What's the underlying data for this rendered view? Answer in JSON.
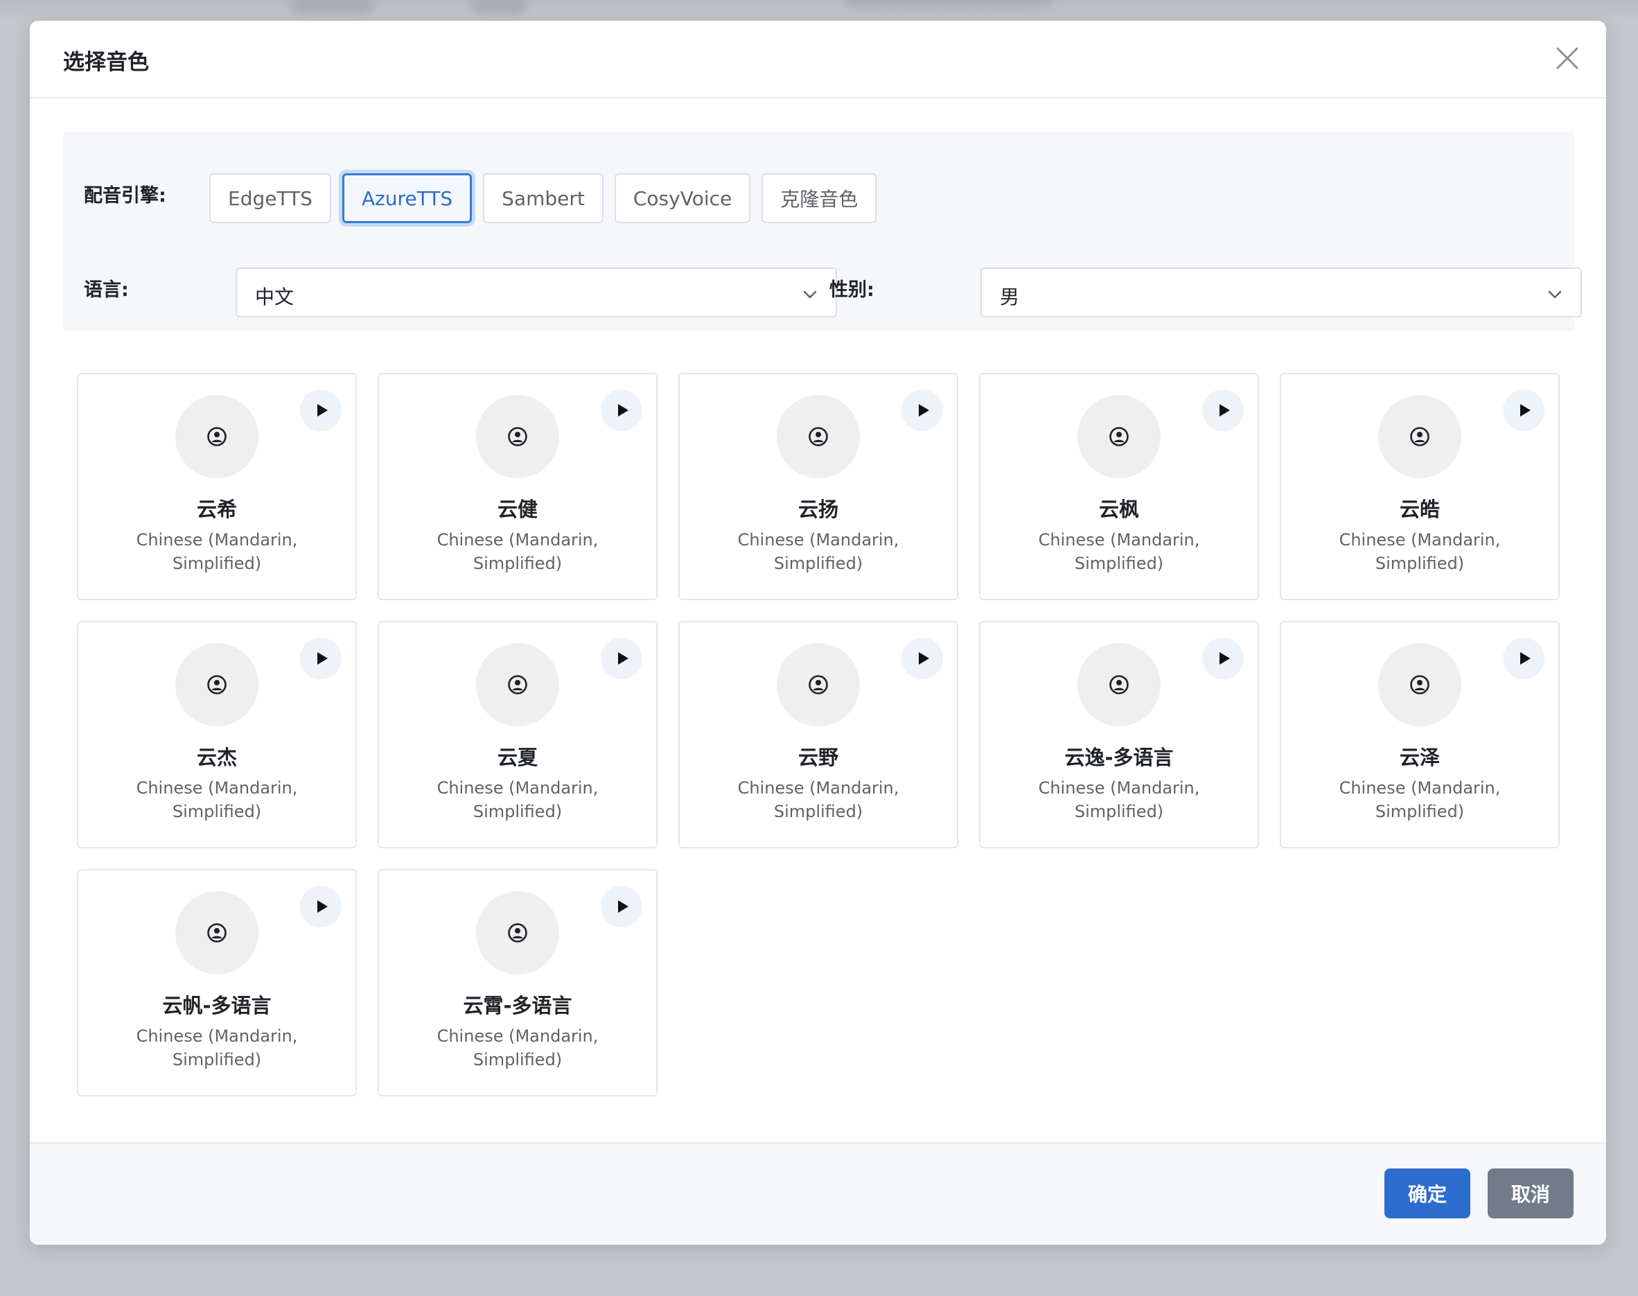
{
  "dialog": {
    "title": "选择音色"
  },
  "filters": {
    "engine_label": "配音引擎:",
    "engines": [
      {
        "label": "EdgeTTS",
        "active": false
      },
      {
        "label": "AzureTTS",
        "active": true
      },
      {
        "label": "Sambert",
        "active": false
      },
      {
        "label": "CosyVoice",
        "active": false
      },
      {
        "label": "克隆音色",
        "active": false
      }
    ],
    "language_label": "语言:",
    "language_value": "中文",
    "gender_label": "性别:",
    "gender_value": "男"
  },
  "voices": [
    {
      "name": "云希",
      "language": "Chinese (Mandarin, Simplified)"
    },
    {
      "name": "云健",
      "language": "Chinese (Mandarin, Simplified)"
    },
    {
      "name": "云扬",
      "language": "Chinese (Mandarin, Simplified)"
    },
    {
      "name": "云枫",
      "language": "Chinese (Mandarin, Simplified)"
    },
    {
      "name": "云皓",
      "language": "Chinese (Mandarin, Simplified)"
    },
    {
      "name": "云杰",
      "language": "Chinese (Mandarin, Simplified)"
    },
    {
      "name": "云夏",
      "language": "Chinese (Mandarin, Simplified)"
    },
    {
      "name": "云野",
      "language": "Chinese (Mandarin, Simplified)"
    },
    {
      "name": "云逸-多语言",
      "language": "Chinese (Mandarin, Simplified)"
    },
    {
      "name": "云泽",
      "language": "Chinese (Mandarin, Simplified)"
    },
    {
      "name": "云帆-多语言",
      "language": "Chinese (Mandarin, Simplified)"
    },
    {
      "name": "云霄-多语言",
      "language": "Chinese (Mandarin, Simplified)"
    }
  ],
  "footer": {
    "confirm_label": "确定",
    "cancel_label": "取消"
  },
  "icons": {
    "close": "close-icon",
    "avatar": "user-circle-icon",
    "play": "play-icon",
    "chevron": "chevron-down-icon"
  },
  "colors": {
    "primary": "#2d6ccf",
    "active_tab_border": "#3a79d4",
    "cancel": "#727b8a"
  }
}
